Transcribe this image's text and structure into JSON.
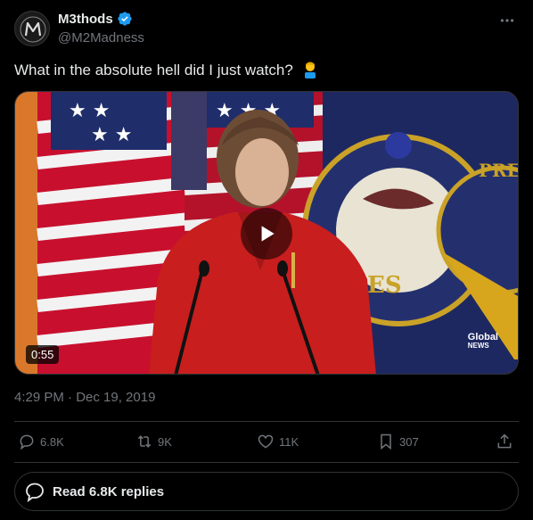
{
  "author": {
    "display_name": "M3thods",
    "handle": "@M2Madness",
    "verified": true,
    "avatar_icon": "avatar-logo-icon"
  },
  "tweet": {
    "text": "What in the absolute hell did I just watch?",
    "emoji_icon": "facepalm-emoji-icon"
  },
  "media": {
    "type": "video",
    "duration": "0:55",
    "watermark_line1": "Global",
    "watermark_line2": "NEWS",
    "play_icon": "play-icon"
  },
  "meta": {
    "timestamp": "4:29 PM · Dec 19, 2019"
  },
  "actions": {
    "replies": "6.8K",
    "reposts": "9K",
    "likes": "11K",
    "bookmarks": "307"
  },
  "replies_button": {
    "label": "Read 6.8K replies"
  },
  "colors": {
    "background": "#000000",
    "text": "#e7e9ea",
    "secondary_text": "#71767b",
    "border": "#2f3336",
    "verified_blue": "#1d9bf0"
  }
}
